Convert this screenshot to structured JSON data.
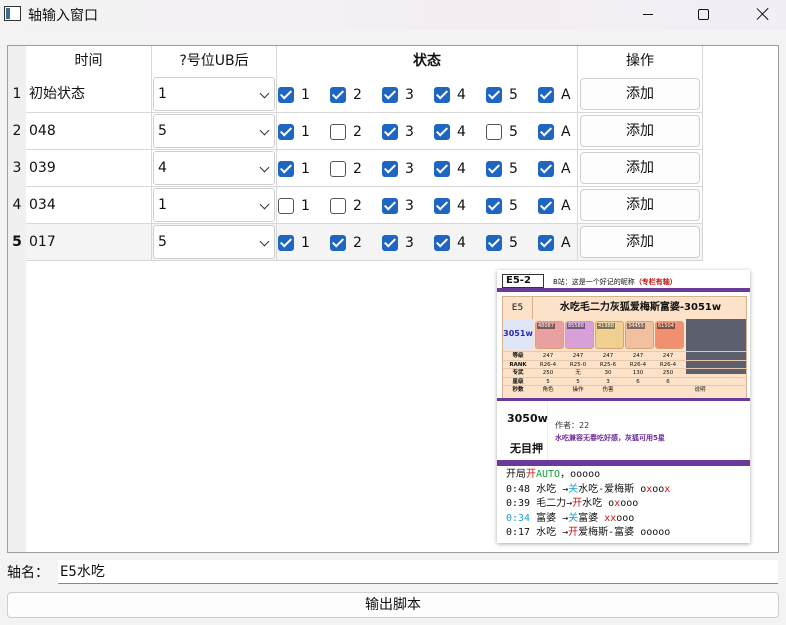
{
  "window": {
    "title": "轴输入窗口",
    "controls": {
      "minimize": "minimize",
      "maximize": "maximize",
      "close": "close"
    }
  },
  "table": {
    "headers": {
      "time": "时间",
      "ub": "?号位UB后",
      "status": "状态",
      "action": "操作"
    },
    "rows": [
      {
        "num": "1",
        "time": "初始状态",
        "ub": "1",
        "checks": [
          true,
          true,
          true,
          true,
          true,
          true
        ],
        "action": "添加"
      },
      {
        "num": "2",
        "time": "048",
        "ub": "5",
        "checks": [
          true,
          false,
          true,
          true,
          false,
          true
        ],
        "action": "添加"
      },
      {
        "num": "3",
        "time": "039",
        "ub": "4",
        "checks": [
          true,
          false,
          true,
          true,
          true,
          true
        ],
        "action": "添加"
      },
      {
        "num": "4",
        "time": "034",
        "ub": "1",
        "checks": [
          false,
          false,
          true,
          true,
          true,
          true
        ],
        "action": "添加"
      },
      {
        "num": "5",
        "time": "017",
        "ub": "5",
        "checks": [
          true,
          true,
          true,
          true,
          true,
          true
        ],
        "action": "添加"
      }
    ],
    "check_labels": [
      "1",
      "2",
      "3",
      "4",
      "5",
      "A"
    ]
  },
  "preview": {
    "stage": "E5-2",
    "note_prefix": "B站：这是一个好记的昵称",
    "note_tag": "（专栏有轴）",
    "boss_level": "E5",
    "team_name": "水吃毛二力灰狐爱梅斯富婆-3051w",
    "team_damage": "3051w",
    "avatar_captions": [
      "48087",
      "85588",
      "41988",
      "34455",
      "61504"
    ],
    "avatar_colors": [
      "#e8a0a0",
      "#d8a0d8",
      "#f0d090",
      "#f0c0a0",
      "#f09070"
    ],
    "stats": [
      [
        "等级",
        "247",
        "247",
        "247",
        "247",
        "247"
      ],
      [
        "RANK",
        "R26-4",
        "R25-0",
        "R25-6",
        "R26-4",
        "R26-4"
      ],
      [
        "专武",
        "250",
        "无",
        "30",
        "130",
        "250"
      ],
      [
        "星级",
        "5",
        "5",
        "3",
        "6",
        "6"
      ],
      [
        "秒数",
        "角色",
        "操作",
        "伤害",
        "",
        "说明"
      ]
    ],
    "score": "3050w",
    "no_deposit": "无目押",
    "author": "作者：22",
    "desc": "水吃兼容无春吃好感，灰狐可用5星",
    "lines": {
      "l1a": "开局",
      "l1b": "开",
      "l1c": "AUTO",
      "l1d": "，ooooo",
      "l2a": "0:48 水吃 →",
      "l2b": "关",
      "l2c": "水吃-爱梅斯 o",
      "l2d": "x",
      "l2e": "oo",
      "l2f": "x",
      "l3a": "0:39 毛二力→",
      "l3b": "开",
      "l3c": "水吃 o",
      "l3d": "x",
      "l3e": "ooo",
      "l4a": "0:34",
      "l4b": " 富婆 →",
      "l4c": "关",
      "l4d": "富婆 ",
      "l4e": "xx",
      "l4f": "ooo",
      "l5a": "0:17 水吃 →",
      "l5b": "开",
      "l5c": "爱梅斯-富婆 ooooo"
    }
  },
  "bottom": {
    "axis_label": "轴名：",
    "axis_value": "E5水吃",
    "export_label": "输出脚本"
  }
}
